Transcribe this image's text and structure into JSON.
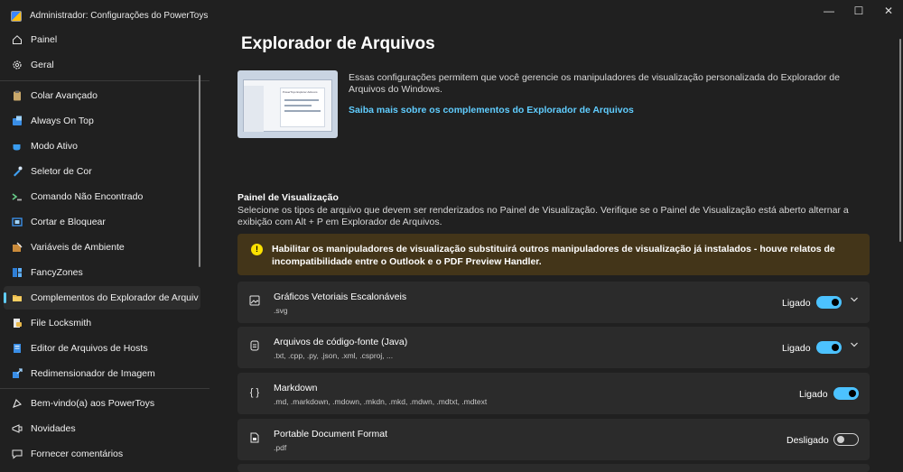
{
  "window": {
    "title": "Administrador: Configurações do PowerToys",
    "controls": {
      "minimize": "—",
      "maximize": "☐",
      "close": "✕"
    }
  },
  "sidebar": {
    "top_items": [
      {
        "label": "Painel",
        "icon": "home-icon"
      },
      {
        "label": "Geral",
        "icon": "gear-icon"
      }
    ],
    "items": [
      {
        "label": "Colar Avançado",
        "icon": "clipboard-icon"
      },
      {
        "label": "Always On Top",
        "icon": "pin-window-icon"
      },
      {
        "label": "Modo Ativo",
        "icon": "awake-cup-icon"
      },
      {
        "label": "Seletor de Cor",
        "icon": "color-picker-icon"
      },
      {
        "label": "Comando Não Encontrado",
        "icon": "command-icon"
      },
      {
        "label": "Cortar e Bloquear",
        "icon": "crop-lock-icon"
      },
      {
        "label": "Variáveis de Ambiente",
        "icon": "environment-icon"
      },
      {
        "label": "FancyZones",
        "icon": "fancyzones-icon"
      },
      {
        "label": "Complementos do Explorador de Arquivos",
        "icon": "folder-icon",
        "selected": true
      },
      {
        "label": "File Locksmith",
        "icon": "lock-icon"
      },
      {
        "label": "Editor de Arquivos de Hosts",
        "icon": "hosts-file-icon"
      },
      {
        "label": "Redimensionador de Imagem",
        "icon": "image-resize-icon"
      }
    ],
    "bottom_items": [
      {
        "label": "Bem-vindo(a) aos PowerToys",
        "icon": "welcome-icon"
      },
      {
        "label": "Novidades",
        "icon": "news-icon"
      },
      {
        "label": "Fornecer comentários",
        "icon": "feedback-icon"
      }
    ]
  },
  "page": {
    "title": "Explorador de Arquivos",
    "hero_image_title": "PowerToys Explorer Add-ons",
    "description": "Essas configurações permitem que você gerencie os manipuladores de visualização personalizada do Explorador de Arquivos do Windows.",
    "learn_more_link": "Saiba mais sobre os complementos do Explorador de Arquivos"
  },
  "preview_pane": {
    "title": "Painel de Visualização",
    "description": "Selecione os tipos de arquivo que devem ser renderizados no Painel de Visualização. Verifique se o Painel de Visualização está aberto alternar a exibição com Alt + P em Explorador de Arquivos.",
    "warning": "Habilitar os manipuladores de visualização substituirá outros manipuladores de visualização já instalados - houve relatos de incompatibilidade entre o Outlook e o PDF Preview Handler.",
    "handlers": [
      {
        "title": "Gráficos Vetoriais Escalonáveis",
        "extensions": ".svg",
        "state_label": "Ligado",
        "enabled": true,
        "expandable": true,
        "icon": "image-icon"
      },
      {
        "title": "Arquivos de código-fonte (Java)",
        "extensions": ".txt, .cpp, .py, .json, .xml, .csproj, ...",
        "state_label": "Ligado",
        "enabled": true,
        "expandable": true,
        "icon": "code-file-icon"
      },
      {
        "title": "Markdown",
        "extensions": ".md, .markdown, .mdown, .mkdn, .mkd, .mdwn, .mdtxt, .mdtext",
        "state_label": "Ligado",
        "enabled": true,
        "expandable": false,
        "icon": "braces-icon"
      },
      {
        "title": "Portable Document Format",
        "extensions": ".pdf",
        "state_label": "Desligado",
        "enabled": false,
        "expandable": false,
        "icon": "pdf-icon"
      }
    ]
  },
  "colors": {
    "background": "#202020",
    "card": "#2b2b2b",
    "accent": "#60cdff",
    "toggle_on": "#4cc2ff",
    "warning_bg": "#433519",
    "warning_icon": "#fce100"
  }
}
